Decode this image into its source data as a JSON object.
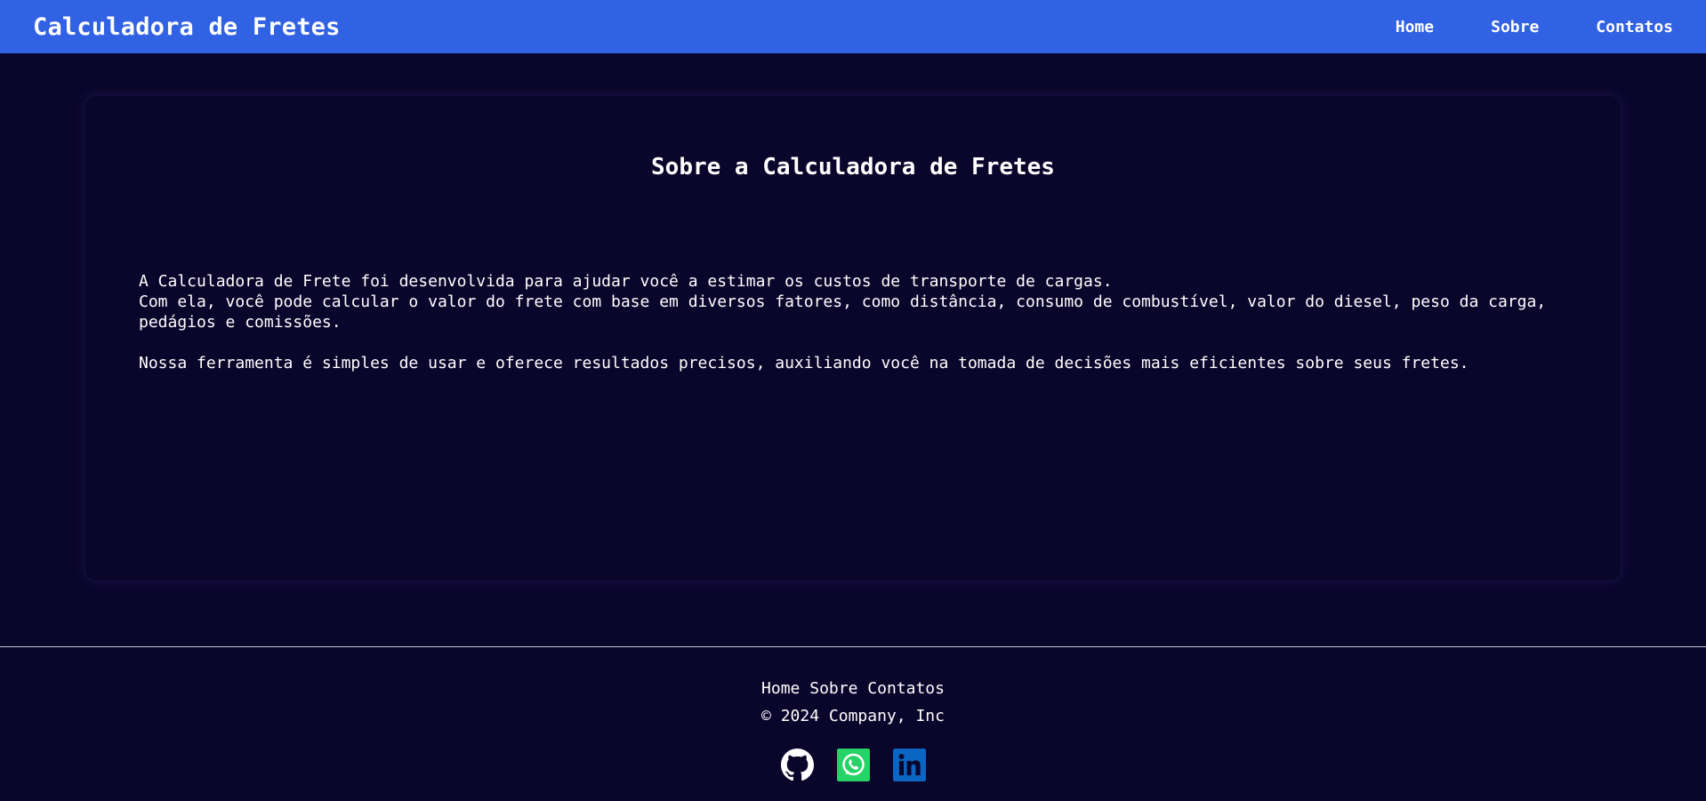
{
  "navbar": {
    "brand": "Calculadora de Fretes",
    "links": [
      "Home",
      "Sobre",
      "Contatos"
    ]
  },
  "card": {
    "title": "Sobre a Calculadora de Fretes",
    "line1": "A Calculadora de Frete foi desenvolvida para ajudar você a estimar os custos de transporte de cargas.",
    "line2": "Com ela, você pode calcular o valor do frete com base em diversos fatores, como distância, consumo de combustível, valor do diesel, peso da carga,",
    "line3": "pedágios e comissões.",
    "line4": "Nossa ferramenta é simples de usar e oferece resultados precisos, auxiliando você na tomada de decisões mais eficientes sobre seus fretes."
  },
  "footer": {
    "links": [
      "Home",
      "Sobre",
      "Contatos"
    ],
    "copyright": "© 2024 Company, Inc",
    "socials": [
      "github-icon",
      "whatsapp-icon",
      "linkedin-icon"
    ]
  },
  "colors": {
    "navbar": "#3162e4",
    "background": "#0a052b",
    "whatsapp": "#25d366",
    "linkedin": "#0a66c2"
  }
}
